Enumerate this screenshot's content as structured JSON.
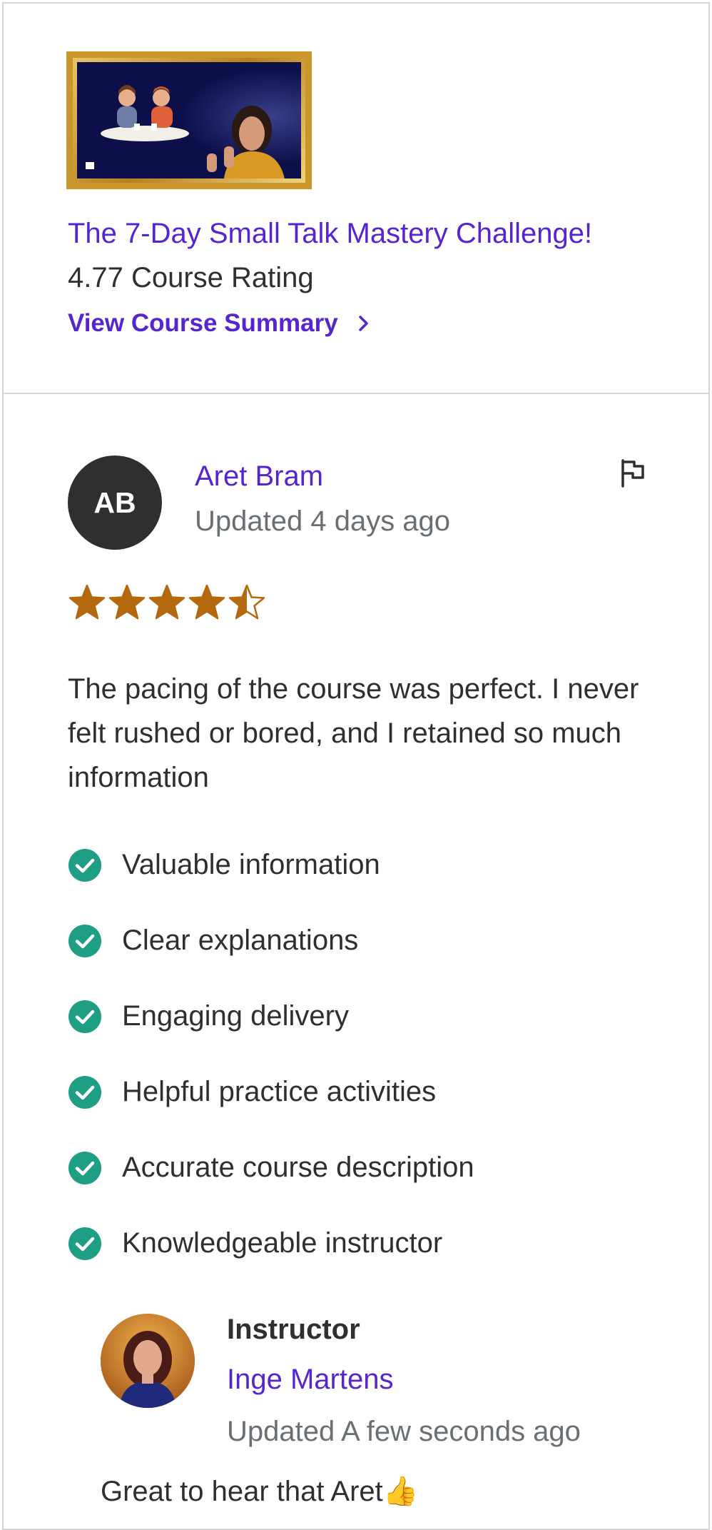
{
  "course": {
    "title": "The 7-Day Small Talk Mastery Challenge!",
    "rating_text": "4.77 Course Rating",
    "summary_link_label": "View Course Summary",
    "summary_link_icon": "chevron-right-icon"
  },
  "review": {
    "avatar_initials": "AB",
    "reviewer_name": "Aret Bram",
    "updated": "Updated 4 days ago",
    "flag_icon": "flag-icon",
    "stars": 4.5,
    "text": "The pacing of the course was perfect. I never felt rushed or bored, and I retained so much information",
    "highlights": [
      "Valuable information",
      "Clear explanations",
      "Engaging delivery",
      "Helpful practice activities",
      "Accurate course description",
      "Knowledgeable instructor"
    ]
  },
  "instructor_response": {
    "label": "Instructor",
    "name": "Inge Martens",
    "updated": "Updated A few seconds ago",
    "reply": "Great to hear that Aret👍"
  },
  "colors": {
    "link": "#5624d0",
    "star": "#b4690e",
    "check": "#1e9e82",
    "muted": "#6a6f73",
    "text": "#2d2f31"
  }
}
